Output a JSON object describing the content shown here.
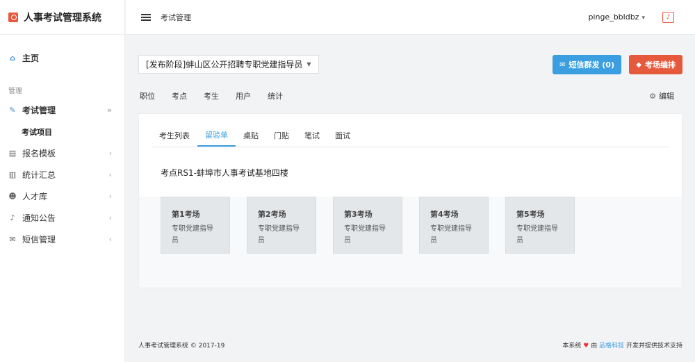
{
  "app": {
    "title": "人事考试管理系统"
  },
  "sidebar": {
    "home_label": "主页",
    "section_label": "管理",
    "active_item": "考试管理",
    "sub_item": "考试项目",
    "items": [
      {
        "label": "报名模板",
        "icon": "id-card-icon"
      },
      {
        "label": "统计汇总",
        "icon": "bar-chart-icon"
      },
      {
        "label": "人才库",
        "icon": "users-icon"
      },
      {
        "label": "通知公告",
        "icon": "bell-icon"
      },
      {
        "label": "短信管理",
        "icon": "envelope-icon"
      }
    ]
  },
  "topbar": {
    "breadcrumb": "考试管理",
    "username": "pinge_bbldbz"
  },
  "main": {
    "exam_select": "[发布阶段]蚌山区公开招聘专职党建指导员",
    "sms_button": "短信群发 (0)",
    "arrange_button": "考场编排",
    "edit_label": "编辑",
    "top_tabs": [
      "职位",
      "考点",
      "考生",
      "用户",
      "统计"
    ],
    "sub_tabs": [
      "考生列表",
      "留验单",
      "桌贴",
      "门贴",
      "笔试",
      "面试"
    ],
    "active_sub_tab": "留验单",
    "site_title": "考点RS1-蚌埠市人事考试基地四楼",
    "rooms": [
      {
        "name": "第1考场",
        "desc": "专职党建指导员"
      },
      {
        "name": "第2考场",
        "desc": "专职党建指导员"
      },
      {
        "name": "第3考场",
        "desc": "专职党建指导员"
      },
      {
        "name": "第4考场",
        "desc": "专职党建指导员"
      },
      {
        "name": "第5考场",
        "desc": "专职党建指导员"
      }
    ]
  },
  "footer": {
    "left": "人事考试管理系统 © 2017-19",
    "right_prefix": "本系统",
    "right_by": "由",
    "right_link": "品格科技",
    "right_suffix": "开发并提供技术支持"
  },
  "colors": {
    "accent": "#3b9ee0",
    "danger": "#e55a3c"
  }
}
